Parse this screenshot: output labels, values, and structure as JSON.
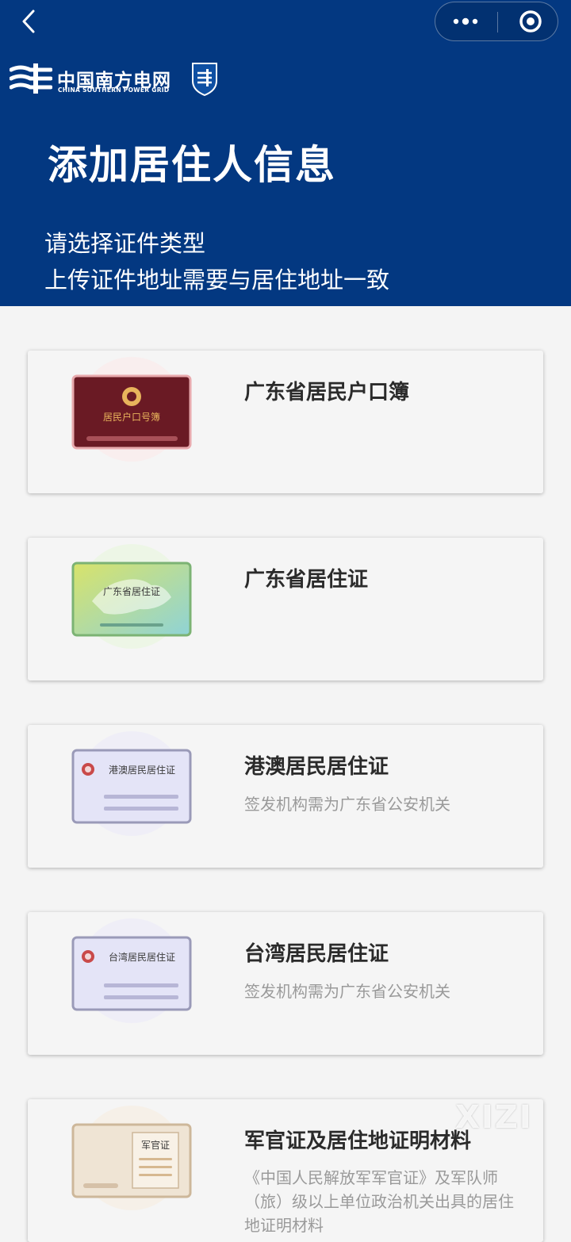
{
  "header": {
    "logo_cn": "中国南方电网",
    "logo_en": "CHINA SOUTHERN POWER GRID",
    "title": "添加居住人信息",
    "subtitle_1": "请选择证件类型",
    "subtitle_2": "上传证件地址需要与居住地址一致"
  },
  "icons": {
    "back": "chevron-left-icon",
    "more": "more-dots-icon",
    "close": "circle-close-icon"
  },
  "cards": [
    {
      "title": "广东省居民户口簿",
      "desc": "",
      "card_label": "居民户口号簿"
    },
    {
      "title": "广东省居住证",
      "desc": "",
      "card_label": "广东省居住证"
    },
    {
      "title": "港澳居民居住证",
      "desc": "签发机构需为广东省公安机关",
      "card_label": "港澳居民居住证"
    },
    {
      "title": "台湾居民居住证",
      "desc": "签发机构需为广东省公安机关",
      "card_label": "台湾居民居住证"
    },
    {
      "title": "军官证及居住地证明材料",
      "desc": "《中国人民解放军军官证》及军队师（旅）级以上单位政治机关出具的居住地证明材料",
      "card_label": "军官证"
    }
  ],
  "watermark": "XIZI",
  "colors": {
    "header_bg": "#033881",
    "page_bg": "#f4f4f4",
    "card_bg": "#f5f5f5",
    "title_text": "#2b2b2b",
    "desc_text": "#9a9a9a"
  }
}
